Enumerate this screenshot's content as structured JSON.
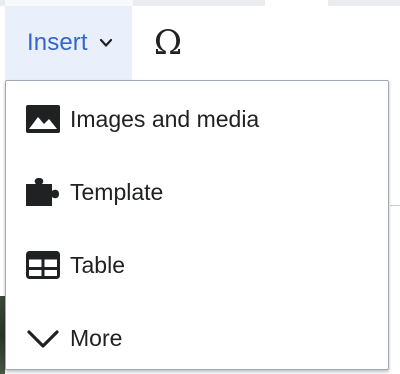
{
  "toolbar": {
    "insert_label": "Insert",
    "insert_chevron_icon": "chevron-down-icon",
    "special_character_icon": "omega-icon",
    "special_character_glyph": "Ω"
  },
  "menu": {
    "items": [
      {
        "label": "Images and media",
        "icon": "image-icon"
      },
      {
        "label": "Template",
        "icon": "puzzle-icon"
      },
      {
        "label": "Table",
        "icon": "table-icon"
      },
      {
        "label": "More",
        "icon": "chevron-down-icon"
      }
    ]
  },
  "colors": {
    "accent": "#3366cc",
    "active_button_bg": "#eaf0fb",
    "text": "#202122",
    "menu_border": "#a2a9b1"
  }
}
